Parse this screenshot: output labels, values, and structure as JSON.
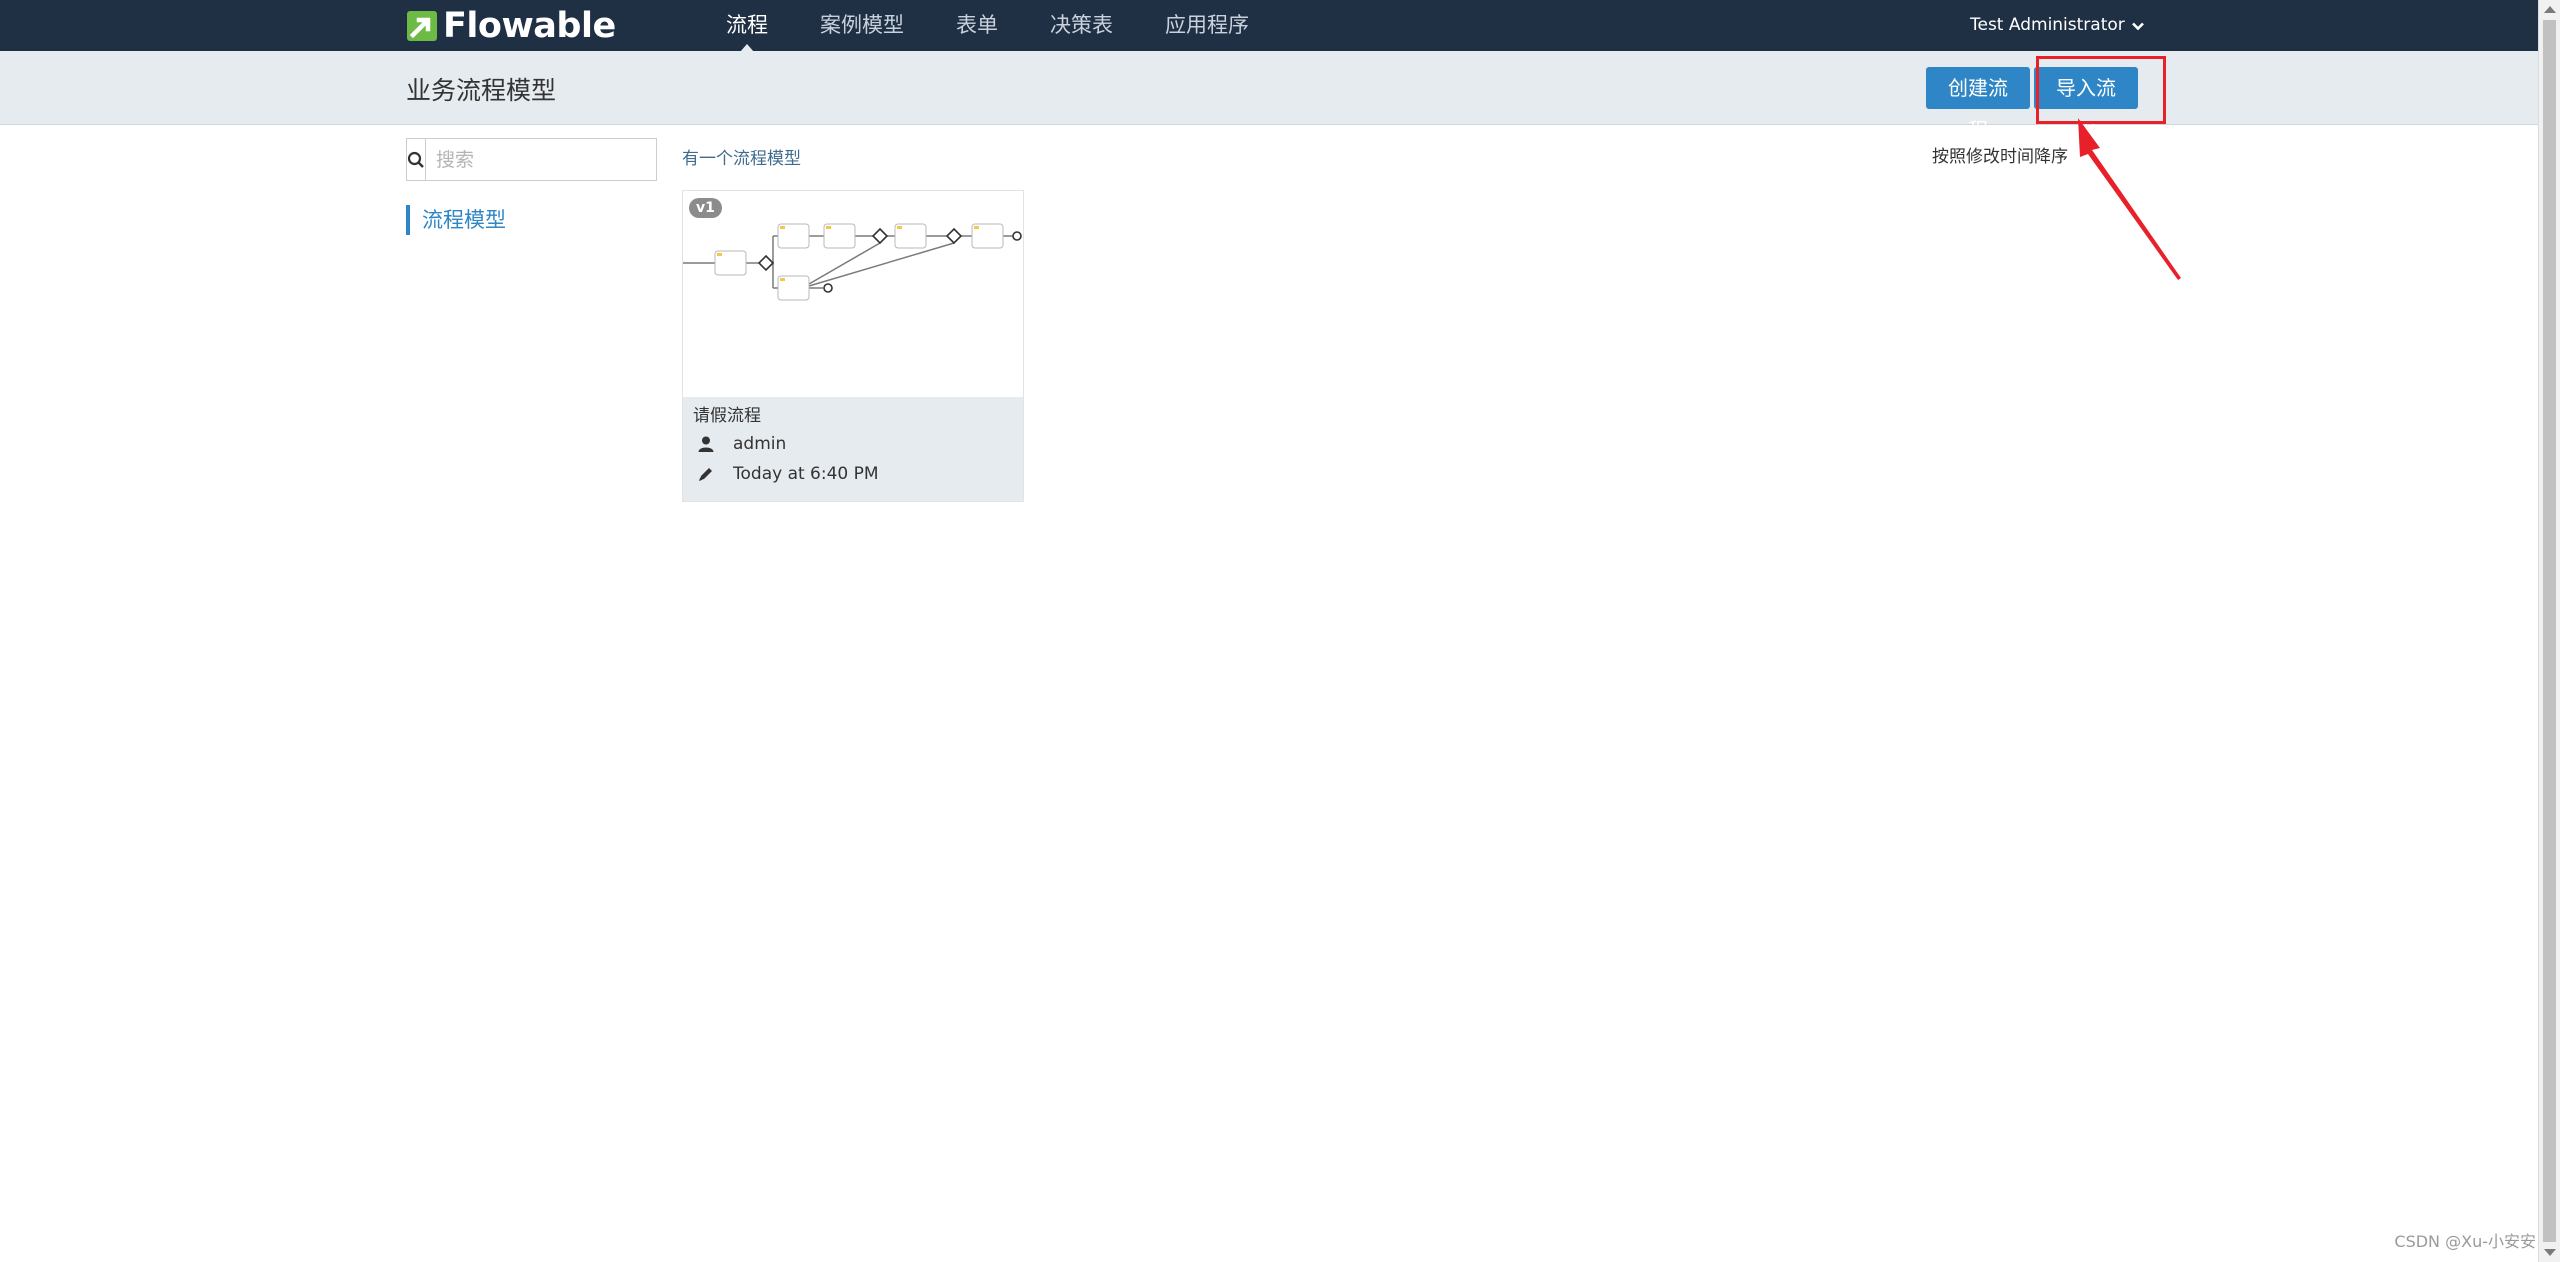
{
  "navbar": {
    "logo_text": "Flowable",
    "items": [
      {
        "label": "流程",
        "active": true
      },
      {
        "label": "案例模型",
        "active": false
      },
      {
        "label": "表单",
        "active": false
      },
      {
        "label": "决策表",
        "active": false
      },
      {
        "label": "应用程序",
        "active": false
      }
    ],
    "user": "Test Administrator",
    "user_icon": "chevron-down-icon"
  },
  "subheader": {
    "title": "业务流程模型",
    "create_button": "创建流程",
    "import_button": "导入流程"
  },
  "sidebar": {
    "search_placeholder": "搜索",
    "search_icon": "search-icon",
    "items": [
      {
        "label": "流程模型"
      }
    ]
  },
  "main": {
    "count_text": "有一个流程模型",
    "sort_label": "按照修改时间降序",
    "cards": [
      {
        "version": "v1",
        "name": "请假流程",
        "author": "admin",
        "modified": "Today at 6:40 PM"
      }
    ]
  },
  "watermark": "CSDN @Xu-小安安",
  "colors": {
    "navbar_bg": "#1f3044",
    "accent": "#2f86c6",
    "subheader_bg": "#e6ebef",
    "annotation_red": "#e8202a"
  }
}
